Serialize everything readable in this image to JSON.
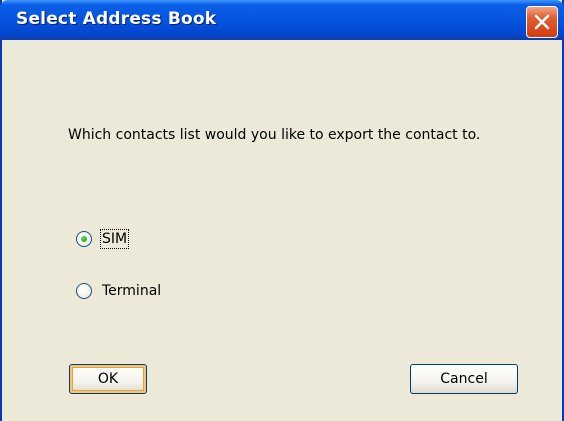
{
  "dialog": {
    "title": "Select Address Book",
    "message": "Which contacts list would you like to export the contact to.",
    "options": [
      {
        "label": "SIM",
        "selected": true
      },
      {
        "label": "Terminal",
        "selected": false
      }
    ],
    "buttons": {
      "ok_label": "OK",
      "cancel_label": "Cancel"
    }
  },
  "colors": {
    "titlebar": "#0655e0",
    "dialog_bg": "#ece9d8",
    "close_button": "#d23b0f",
    "radio_selected": "#21a121",
    "default_button_highlight": "#f5c673"
  },
  "icons": {
    "close": "close-icon"
  }
}
